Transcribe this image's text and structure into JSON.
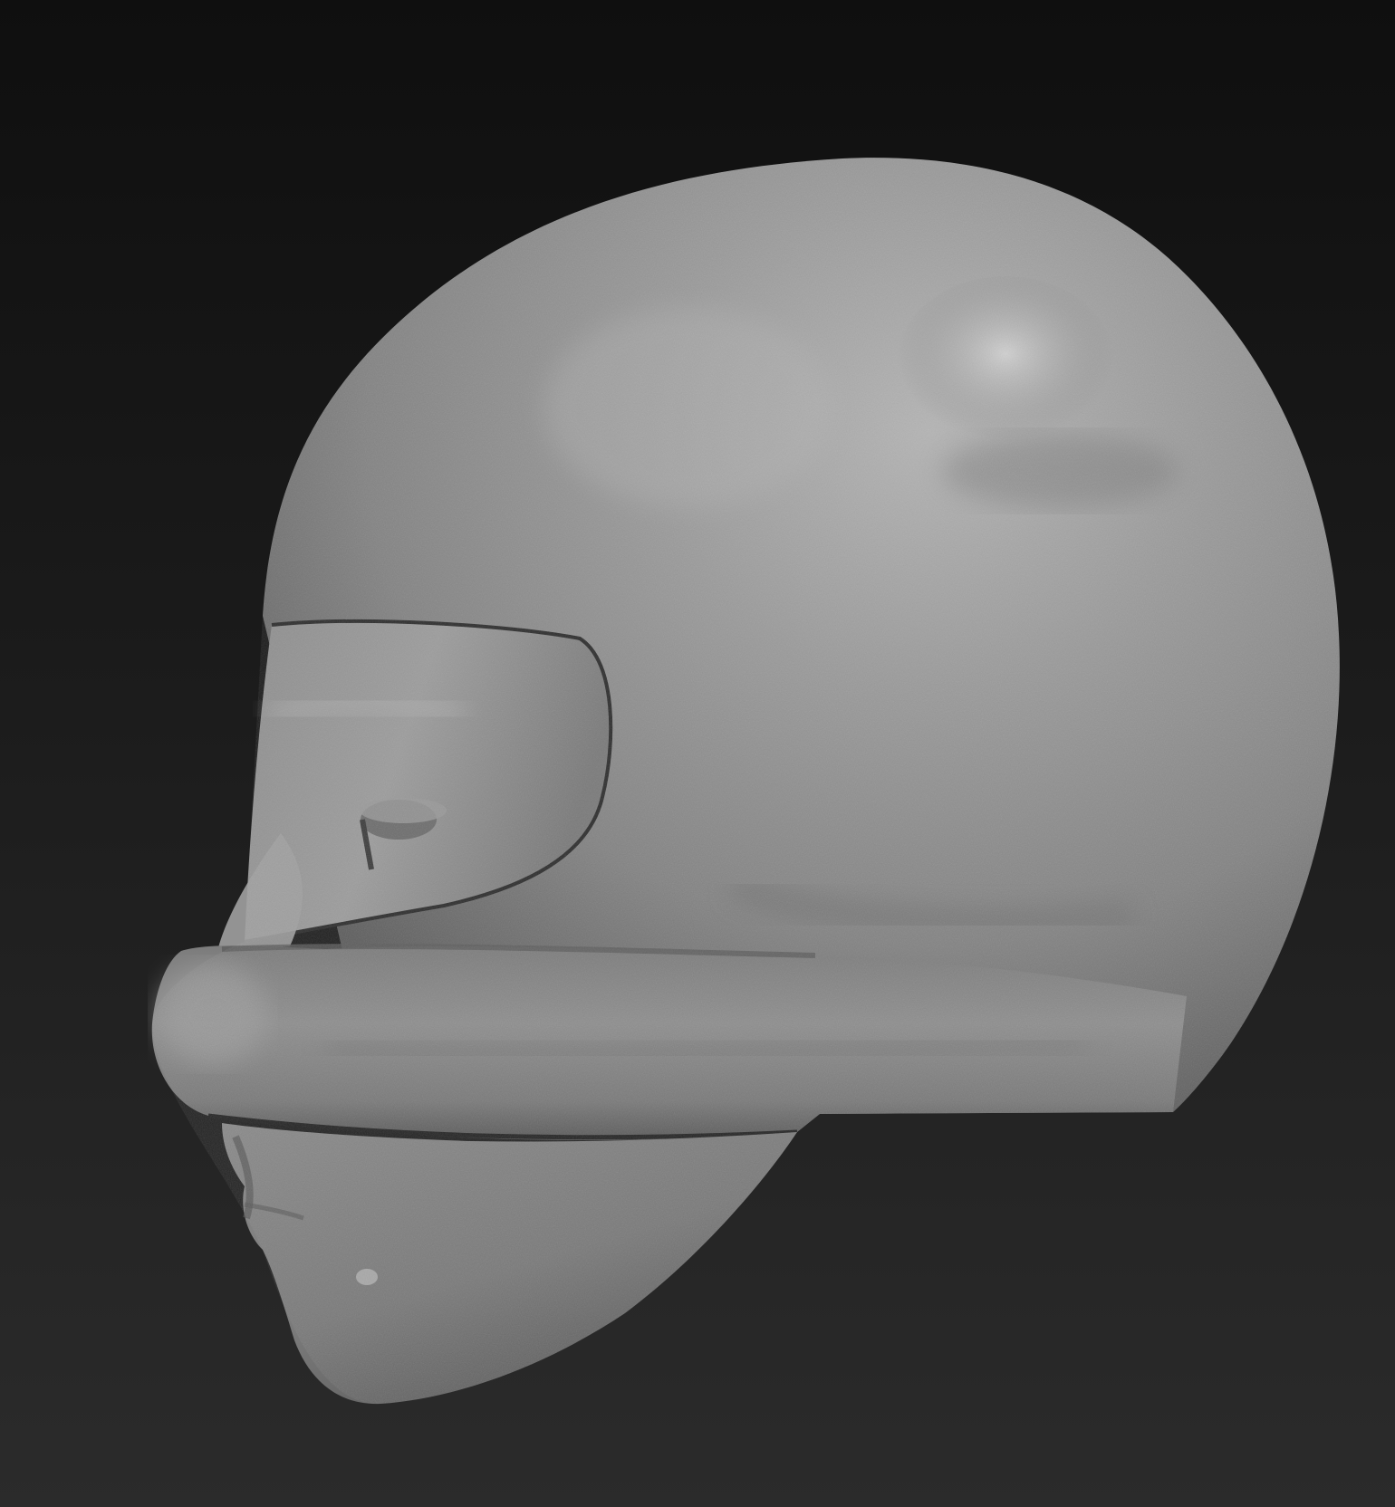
{
  "scene": {
    "subject": "sculpt-head-mask-profile",
    "background_top": "#0f0f0f",
    "background_bottom": "#2b2b2b",
    "clay_color": "#8a8a8a",
    "clay_highlight": "#c4c4c4",
    "clay_shadow": "#4a4a4a"
  }
}
